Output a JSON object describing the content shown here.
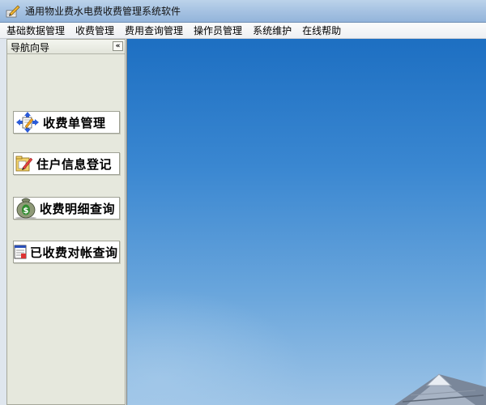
{
  "window": {
    "title": "通用物业费水电费收费管理系统软件"
  },
  "menu": {
    "items": [
      "基础数据管理",
      "收费管理",
      "费用查询管理",
      "操作员管理",
      "系统维护",
      "在线帮助"
    ]
  },
  "nav": {
    "header": "导航向导",
    "collapse_glyph": "«",
    "buttons": [
      {
        "label": "收费单管理",
        "icon": "document-arrows-icon"
      },
      {
        "label": "住户信息登记",
        "icon": "folder-edit-icon"
      },
      {
        "label": "收费明细查询",
        "icon": "money-bag-icon"
      },
      {
        "label": "已收费对帐查询",
        "icon": "report-icon"
      }
    ]
  },
  "colors": {
    "title_bar": "#a8c4e3",
    "nav_bg": "#e6e8dd",
    "sky": "#3a87d1"
  }
}
